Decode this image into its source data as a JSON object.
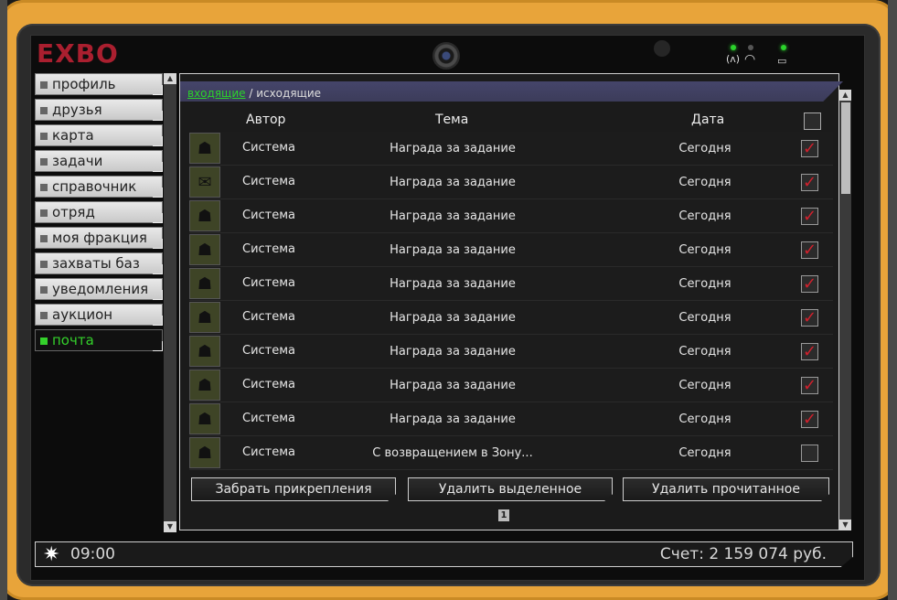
{
  "device": {
    "logo": "EXBO"
  },
  "sidebar": {
    "items": [
      {
        "label": "профиль"
      },
      {
        "label": "друзья"
      },
      {
        "label": "карта"
      },
      {
        "label": "задачи"
      },
      {
        "label": "справочник"
      },
      {
        "label": "отряд"
      },
      {
        "label": "моя фракция"
      },
      {
        "label": "захваты баз"
      },
      {
        "label": "уведомления"
      },
      {
        "label": "аукцион"
      },
      {
        "label": "почта",
        "active": true
      }
    ]
  },
  "mail": {
    "tab_inbox": "входящие",
    "tab_separator": " / ",
    "tab_outbox": "исходящие",
    "columns": {
      "author": "Автор",
      "subject": "Тема",
      "date": "Дата"
    },
    "rows": [
      {
        "icon": "stalker-icon",
        "author": "Система",
        "subject": "Награда за задание",
        "date": "Сегодня",
        "checked": true
      },
      {
        "icon": "envelope-icon",
        "author": "Система",
        "subject": "Награда за задание",
        "date": "Сегодня",
        "checked": true
      },
      {
        "icon": "stalker-icon",
        "author": "Система",
        "subject": "Награда за задание",
        "date": "Сегодня",
        "checked": true
      },
      {
        "icon": "stalker-icon",
        "author": "Система",
        "subject": "Награда за задание",
        "date": "Сегодня",
        "checked": true
      },
      {
        "icon": "stalker-icon",
        "author": "Система",
        "subject": "Награда за задание",
        "date": "Сегодня",
        "checked": true
      },
      {
        "icon": "stalker-icon",
        "author": "Система",
        "subject": "Награда за задание",
        "date": "Сегодня",
        "checked": true
      },
      {
        "icon": "stalker-icon",
        "author": "Система",
        "subject": "Награда за задание",
        "date": "Сегодня",
        "checked": true
      },
      {
        "icon": "stalker-icon",
        "author": "Система",
        "subject": "Награда за задание",
        "date": "Сегодня",
        "checked": true
      },
      {
        "icon": "stalker-icon",
        "author": "Система",
        "subject": "Награда за задание",
        "date": "Сегодня",
        "checked": true
      },
      {
        "icon": "stalker-icon",
        "author": "Система",
        "subject": "С возвращением в Зону...",
        "date": "Сегодня",
        "checked": false
      }
    ],
    "buttons": {
      "take_attachments": "Забрать прикрепления",
      "delete_selected": "Удалить выделенное",
      "delete_read": "Удалить прочитанное"
    },
    "page": "1"
  },
  "status_bar": {
    "time": "09:00",
    "balance": "Счет: 2 159 074 руб."
  },
  "colors": {
    "casing": "#e8a43a",
    "active_green": "#34d12b",
    "check_red": "#d0202c",
    "header_bar": "#3c3c5a"
  }
}
